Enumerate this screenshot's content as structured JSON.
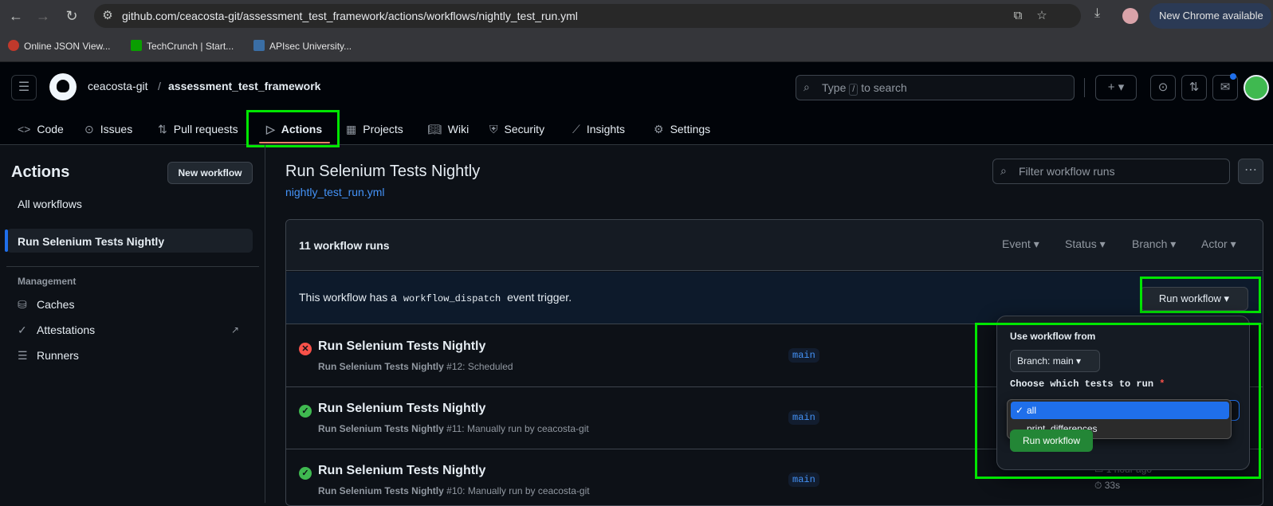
{
  "browser": {
    "url": "github.com/ceacosta-git/assessment_test_framework/actions/workflows/nightly_test_run.yml",
    "new_chrome": "New Chrome available",
    "bookmarks": [
      "Online JSON View...",
      "TechCrunch | Start...",
      "APIsec University..."
    ]
  },
  "header": {
    "owner": "ceacosta-git",
    "separator": "/",
    "repo": "assessment_test_framework",
    "search_prefix": "Type",
    "search_key": "/",
    "search_suffix": "to search"
  },
  "tabs": [
    "Code",
    "Issues",
    "Pull requests",
    "Actions",
    "Projects",
    "Wiki",
    "Security",
    "Insights",
    "Settings"
  ],
  "sidebar": {
    "title": "Actions",
    "new_workflow": "New workflow",
    "all_workflows": "All workflows",
    "selected_workflow": "Run Selenium Tests Nightly",
    "section": "Management",
    "items": [
      "Caches",
      "Attestations",
      "Runners"
    ]
  },
  "main": {
    "title": "Run Selenium Tests Nightly",
    "file": "nightly_test_run.yml",
    "filter_placeholder": "Filter workflow runs",
    "runs_count": "11 workflow runs",
    "filters": [
      "Event",
      "Status",
      "Branch",
      "Actor"
    ],
    "dispatch_prefix": "This workflow has a",
    "dispatch_code": "workflow_dispatch",
    "dispatch_suffix": "event trigger.",
    "run_workflow_btn": "Run workflow",
    "runs": [
      {
        "title": "Run Selenium Tests Nightly",
        "sub_name": "Run Selenium Tests Nightly",
        "sub_rest": "#12: Scheduled",
        "branch": "main",
        "status": "failure"
      },
      {
        "title": "Run Selenium Tests Nightly",
        "sub_name": "Run Selenium Tests Nightly",
        "sub_rest": "#11: Manually run by ceacosta-git",
        "branch": "main",
        "status": "success"
      },
      {
        "title": "Run Selenium Tests Nightly",
        "sub_name": "Run Selenium Tests Nightly",
        "sub_rest": "#10: Manually run by ceacosta-git",
        "branch": "main",
        "status": "success",
        "time": "1 hour ago",
        "duration": "33s"
      }
    ]
  },
  "popover": {
    "use_from": "Use workflow from",
    "branch_btn": "Branch: main",
    "choose": "Choose which tests to run",
    "required": "*",
    "options": [
      "all",
      "print_differences"
    ],
    "selected_check": "✓",
    "submit": "Run workflow"
  },
  "colors": {
    "highlight": "#00e600",
    "accent": "#1f6feb",
    "success": "#3fb950",
    "failure": "#f85149"
  }
}
